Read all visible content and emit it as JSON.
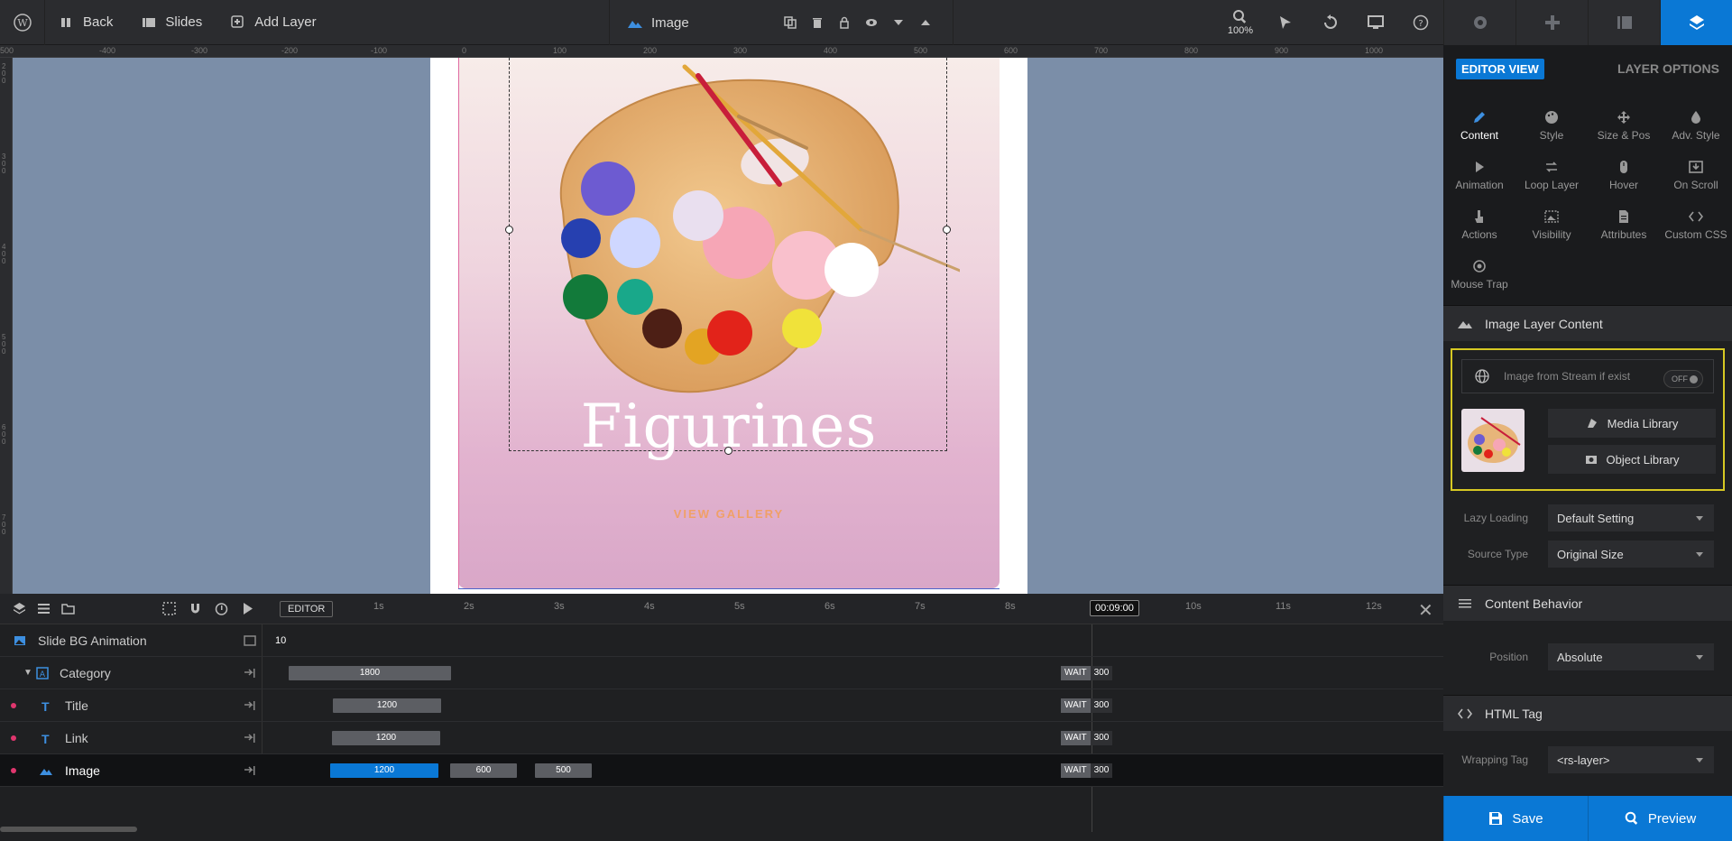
{
  "topbar": {
    "back": "Back",
    "slides": "Slides",
    "add_layer": "Add Layer",
    "selected_layer": "Image",
    "zoom": "100%"
  },
  "ruler": {
    "h_ticks": [
      "500",
      "-400",
      "-300",
      "-200",
      "-100",
      "0",
      "100",
      "200",
      "300",
      "400",
      "500",
      "600",
      "700",
      "800",
      "900",
      "1000"
    ],
    "v_ticks": [
      "200",
      "300",
      "400",
      "500",
      "600",
      "700"
    ]
  },
  "slide": {
    "title": "Figurines",
    "link": "VIEW GALLERY"
  },
  "timeline": {
    "editor_label": "EDITOR",
    "current_time": "00:09:00",
    "ticks": [
      "1s",
      "2s",
      "3s",
      "4s",
      "5s",
      "6s",
      "7s",
      "8s",
      "10s",
      "11s",
      "12s"
    ],
    "rows": [
      {
        "name": "Slide BG Animation",
        "value": "10"
      },
      {
        "name": "Category",
        "bar": "1800",
        "wait": "WAIT",
        "wait_val": "300"
      },
      {
        "name": "Title",
        "bar": "1200",
        "wait": "WAIT",
        "wait_val": "300"
      },
      {
        "name": "Link",
        "bar": "1200",
        "wait": "WAIT",
        "wait_val": "300"
      },
      {
        "name": "Image",
        "bar": "1200",
        "bar2": "600",
        "bar3": "500",
        "wait": "WAIT",
        "wait_val": "300"
      }
    ]
  },
  "panel": {
    "editor_view": "EDITOR VIEW",
    "layer_options": "LAYER OPTIONS",
    "options": [
      "Content",
      "Style",
      "Size & Pos",
      "Adv. Style",
      "Animation",
      "Loop Layer",
      "Hover",
      "On Scroll",
      "Actions",
      "Visibility",
      "Attributes",
      "Custom CSS",
      "Mouse Trap"
    ],
    "section_image": "Image Layer Content",
    "stream_label": "Image from Stream if exist",
    "stream_toggle": "OFF",
    "media_library": "Media Library",
    "object_library": "Object Library",
    "lazy_loading_label": "Lazy Loading",
    "lazy_loading_value": "Default Setting",
    "source_type_label": "Source Type",
    "source_type_value": "Original Size",
    "section_behavior": "Content Behavior",
    "position_label": "Position",
    "position_value": "Absolute",
    "section_html": "HTML Tag",
    "wrapping_tag_label": "Wrapping Tag",
    "wrapping_tag_value": "<rs-layer>",
    "save": "Save",
    "preview": "Preview"
  },
  "colors": {
    "accent": "#0a78d5",
    "highlight": "#d6c823",
    "dot": "#e0366e"
  }
}
